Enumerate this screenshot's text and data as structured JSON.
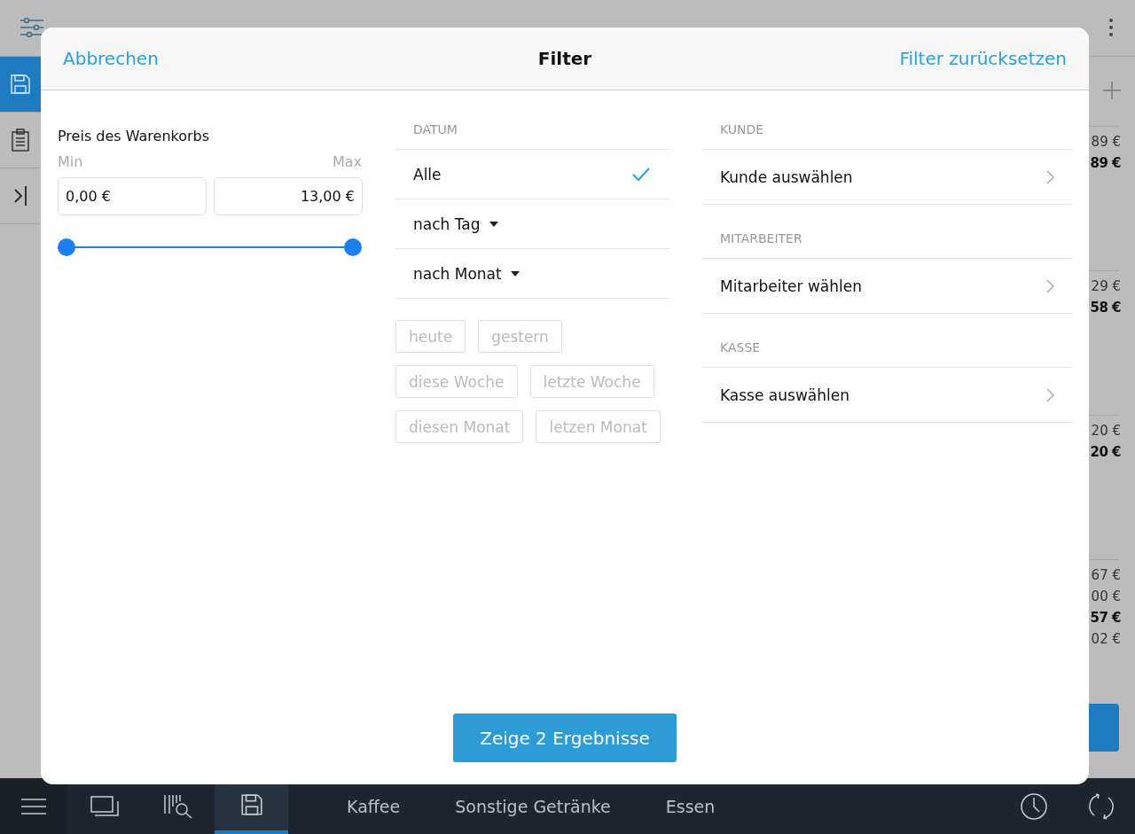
{
  "background": {
    "sidebar": [
      {
        "selected": true
      },
      {
        "selected": false
      },
      {
        "selected": false
      }
    ],
    "amount_groups": [
      {
        "lines": [
          {
            "text": "89 €",
            "bold": false
          },
          {
            "text": "89 €",
            "bold": true
          }
        ]
      },
      {
        "lines": [
          {
            "text": "29 €",
            "bold": false
          },
          {
            "text": "58 €",
            "bold": true
          }
        ]
      },
      {
        "lines": [
          {
            "text": "20 €",
            "bold": false
          },
          {
            "text": "20 €",
            "bold": true
          }
        ]
      },
      {
        "lines": [
          {
            "text": "67 €",
            "bold": false
          },
          {
            "text": "00 €",
            "bold": false
          },
          {
            "text": "57 €",
            "bold": true
          },
          {
            "text": "02 €",
            "bold": false
          }
        ]
      }
    ]
  },
  "dialog": {
    "title": "Filter",
    "cancel": "Abbrechen",
    "reset": "Filter zurücksetzen",
    "price": {
      "label": "Preis des Warenkorbs",
      "min_label": "Min",
      "max_label": "Max",
      "min_value": "0,00 €",
      "max_value": "13,00 €",
      "thumbs": [
        {
          "level": 0
        },
        {
          "level": 1
        }
      ]
    },
    "date": {
      "heading": "DATUM",
      "options": [
        {
          "label": "Alle",
          "kind": "plain",
          "selected": true
        },
        {
          "label": "nach Tag",
          "kind": "dropdown",
          "selected": false
        },
        {
          "label": "nach Monat",
          "kind": "dropdown",
          "selected": false
        }
      ],
      "chips": [
        {
          "label": "heute",
          "disabled": true
        },
        {
          "label": "gestern",
          "disabled": true
        },
        {
          "label": "diese Woche",
          "disabled": true
        },
        {
          "label": "letzte Woche",
          "disabled": true
        },
        {
          "label": "diesen Monat",
          "disabled": true
        },
        {
          "label": "letzen Monat",
          "disabled": true
        }
      ]
    },
    "sections": [
      {
        "heading": "KUNDE",
        "item": "Kunde auswählen"
      },
      {
        "heading": "MITARBEITER",
        "item": "Mitarbeiter wählen"
      },
      {
        "heading": "KASSE",
        "item": "Kasse auswählen"
      }
    ],
    "submit": "Zeige 2 Ergebnisse"
  },
  "bottom_bar": {
    "icons": [
      {
        "selected": false
      },
      {
        "selected": false
      },
      {
        "selected": false
      },
      {
        "selected": true
      }
    ],
    "tabs": [
      {
        "label": "Kaffee",
        "selected": false
      },
      {
        "label": "Sonstige Getränke",
        "selected": false
      },
      {
        "label": "Essen",
        "selected": false
      }
    ]
  }
}
